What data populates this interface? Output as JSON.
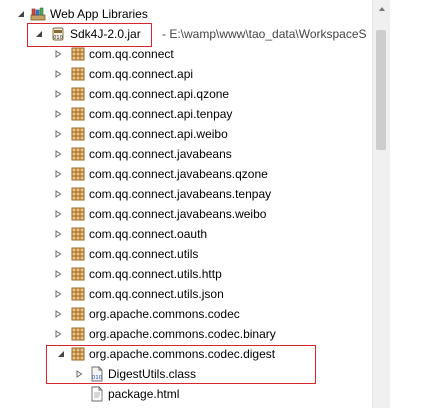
{
  "tree": {
    "root_label": "Web App Libraries",
    "jar": {
      "label": "Sdk4J-2.0.jar",
      "path": "- E:\\wamp\\www\\tao_data\\WorkspaceS"
    },
    "packages": [
      "com.qq.connect",
      "com.qq.connect.api",
      "com.qq.connect.api.qzone",
      "com.qq.connect.api.tenpay",
      "com.qq.connect.api.weibo",
      "com.qq.connect.javabeans",
      "com.qq.connect.javabeans.qzone",
      "com.qq.connect.javabeans.tenpay",
      "com.qq.connect.javabeans.weibo",
      "com.qq.connect.oauth",
      "com.qq.connect.utils",
      "com.qq.connect.utils.http",
      "com.qq.connect.utils.json",
      "org.apache.commons.codec",
      "org.apache.commons.codec.binary"
    ],
    "expanded_package": "org.apache.commons.codec.digest",
    "class_file": "DigestUtils.class",
    "html_file": "package.html"
  },
  "colors": {
    "highlight": "#d9262c",
    "package_icon": "#b8741a",
    "arrow": "#6b6b6b"
  },
  "icons": {
    "expanded": "expanded-arrow-icon",
    "collapsed": "collapsed-arrow-icon",
    "library": "library-icon",
    "jar": "jar-icon",
    "package": "package-icon",
    "class": "class-file-icon",
    "html": "html-file-icon"
  }
}
